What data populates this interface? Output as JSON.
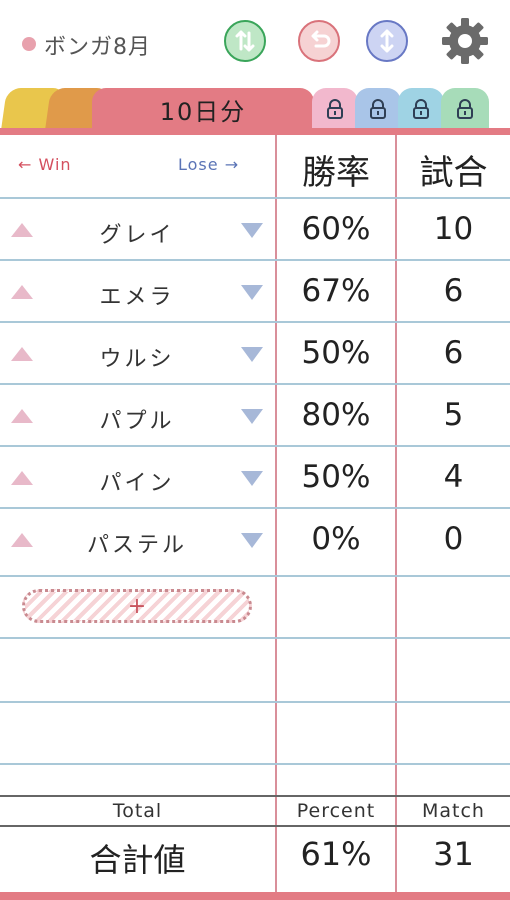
{
  "header": {
    "title": "ボンガ8月",
    "dot_color": "#e8a1ad",
    "buttons": [
      {
        "name": "sort",
        "icon": "swap-vertical-icon",
        "color": "#3aa55a",
        "bg": "#bfe7c6"
      },
      {
        "name": "undo",
        "icon": "undo-icon",
        "color": "#d9727a",
        "bg": "#f6d2d3"
      },
      {
        "name": "resize",
        "icon": "expand-vertical-icon",
        "color": "#6878c4",
        "bg": "#cdd4f3"
      }
    ],
    "settings_icon": "gear-icon"
  },
  "tabs": {
    "active_label": "10日分",
    "colors": {
      "yellow": "#e9c64c",
      "orange": "#e09a4a",
      "active": "#e37b84",
      "pink": "#f2b8cd",
      "blue1": "#a9c5e8",
      "blue2": "#9fd3e4",
      "green": "#a7dcb9"
    },
    "lock_icon": "lock-icon"
  },
  "table": {
    "win_label": "← Win",
    "lose_label": "Lose →",
    "col_rate": "勝率",
    "col_match": "試合",
    "rows": [
      {
        "name": "グレイ",
        "rate": "60%",
        "matches": "10"
      },
      {
        "name": "エメラ",
        "rate": "67%",
        "matches": "6"
      },
      {
        "name": "ウルシ",
        "rate": "50%",
        "matches": "6"
      },
      {
        "name": "パプル",
        "rate": "80%",
        "matches": "5"
      },
      {
        "name": "パイン",
        "rate": "50%",
        "matches": "4"
      },
      {
        "name": "パステル",
        "rate": "0%",
        "matches": "0"
      }
    ],
    "add_label": "+"
  },
  "footer": {
    "total_label": "Total",
    "percent_label": "Percent",
    "match_label": "Match",
    "total_value": "合計値",
    "percent_value": "61%",
    "match_value": "31"
  },
  "colors": {
    "grid_red": "#d98f9a",
    "grid_blue": "#a9c8d8",
    "accent_bar": "#e37b84"
  }
}
